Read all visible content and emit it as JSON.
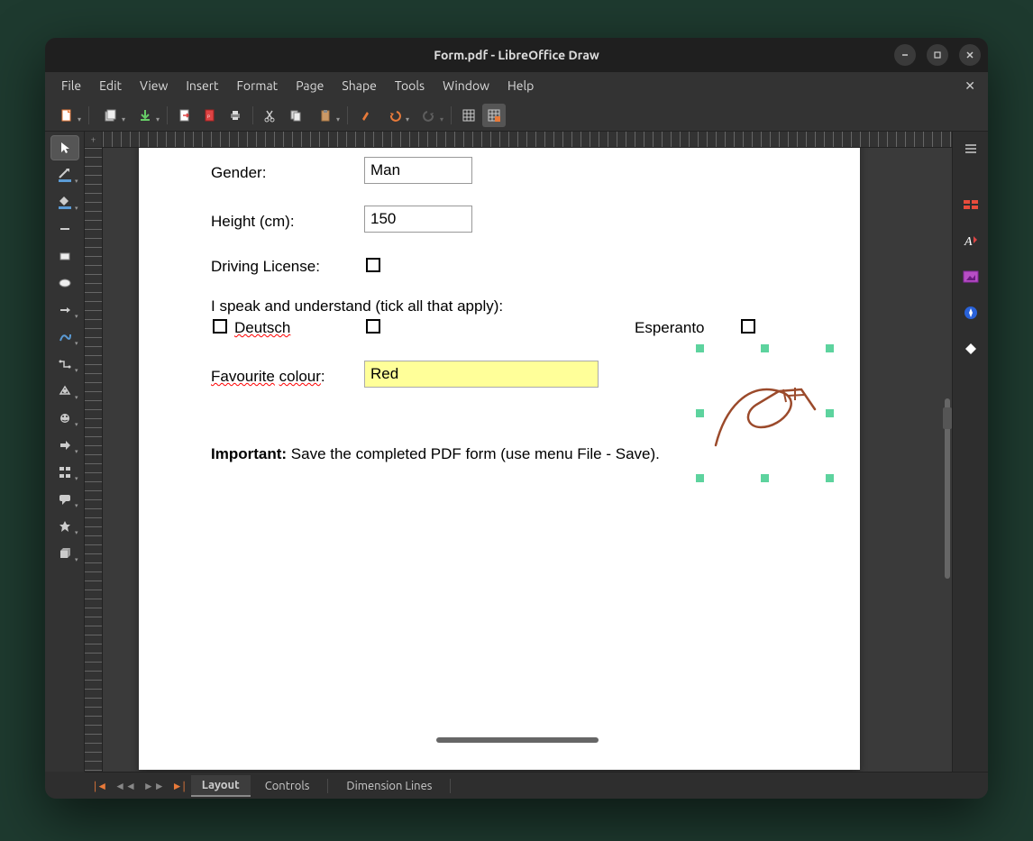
{
  "window": {
    "title": "Form.pdf - LibreOffice Draw"
  },
  "menubar": {
    "items": [
      "File",
      "Edit",
      "View",
      "Insert",
      "Format",
      "Page",
      "Shape",
      "Tools",
      "Window",
      "Help"
    ]
  },
  "form": {
    "gender_label": "Gender:",
    "gender_value": "Man",
    "height_label": "Height (cm):",
    "height_value": "150",
    "license_label": "Driving License:",
    "languages_label": "I speak and understand (tick all that apply):",
    "lang_deutsch": "Deutsch",
    "lang_esperanto": "Esperanto",
    "favcolour_label_part1": "Favourite",
    "favcolour_label_part2": "colour",
    "favcolour_label_sep": " ",
    "favcolour_label_suffix": ":",
    "favcolour_value": "Red",
    "important_prefix": "Important:",
    "important_text": " Save the completed PDF form (use menu File - Save)."
  },
  "tabs": {
    "layout": "Layout",
    "controls": "Controls",
    "dimension": "Dimension Lines"
  }
}
